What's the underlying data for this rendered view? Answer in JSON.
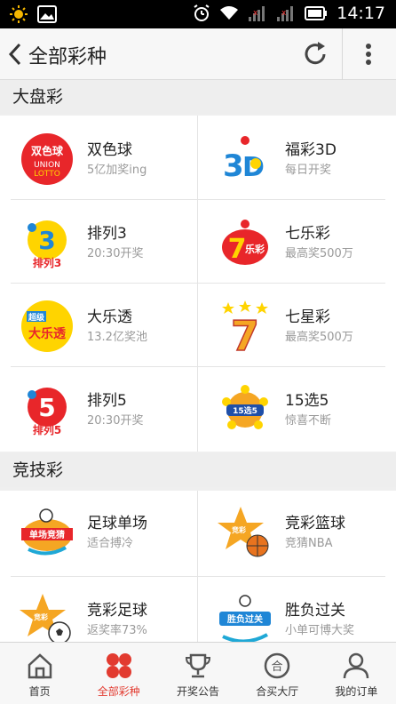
{
  "statusbar": {
    "time": "14:17"
  },
  "header": {
    "title": "全部彩种"
  },
  "sections": [
    {
      "title": "大盘彩",
      "items": [
        {
          "name": "双色球",
          "sub": "5亿加奖ing",
          "icon": "shuangseqiu-logo-icon"
        },
        {
          "name": "福彩3D",
          "sub": "每日开奖",
          "icon": "fucai3d-logo-icon"
        },
        {
          "name": "排列3",
          "sub": "20:30开奖",
          "icon": "pailie3-logo-icon"
        },
        {
          "name": "七乐彩",
          "sub": "最高奖500万",
          "icon": "qilecai-logo-icon"
        },
        {
          "name": "大乐透",
          "sub": "13.2亿奖池",
          "icon": "daletou-logo-icon"
        },
        {
          "name": "七星彩",
          "sub": "最高奖500万",
          "icon": "qixingcai-logo-icon"
        },
        {
          "name": "排列5",
          "sub": "20:30开奖",
          "icon": "pailie5-logo-icon"
        },
        {
          "name": "15选5",
          "sub": "惊喜不断",
          "icon": "15xuan5-logo-icon"
        }
      ]
    },
    {
      "title": "竞技彩",
      "items": [
        {
          "name": "足球单场",
          "sub": "适合搏冷",
          "icon": "soccer-single-logo-icon"
        },
        {
          "name": "竞彩篮球",
          "sub": "竞猜NBA",
          "icon": "basketball-logo-icon"
        },
        {
          "name": "竞彩足球",
          "sub": "返奖率73%",
          "icon": "soccer-logo-icon"
        },
        {
          "name": "胜负过关",
          "sub": "小单可博大奖",
          "icon": "win-lose-logo-icon"
        }
      ]
    }
  ],
  "tabs": [
    {
      "label": "首页",
      "icon": "home-icon"
    },
    {
      "label": "全部彩种",
      "icon": "all-lottery-icon",
      "active": true
    },
    {
      "label": "开奖公告",
      "icon": "trophy-icon"
    },
    {
      "label": "合买大厅",
      "icon": "group-buy-icon"
    },
    {
      "label": "我的订单",
      "icon": "user-icon"
    }
  ],
  "colors": {
    "accent": "#e23b30",
    "header_bg": "#f7f7f7",
    "section_bg": "#eeeeee"
  }
}
